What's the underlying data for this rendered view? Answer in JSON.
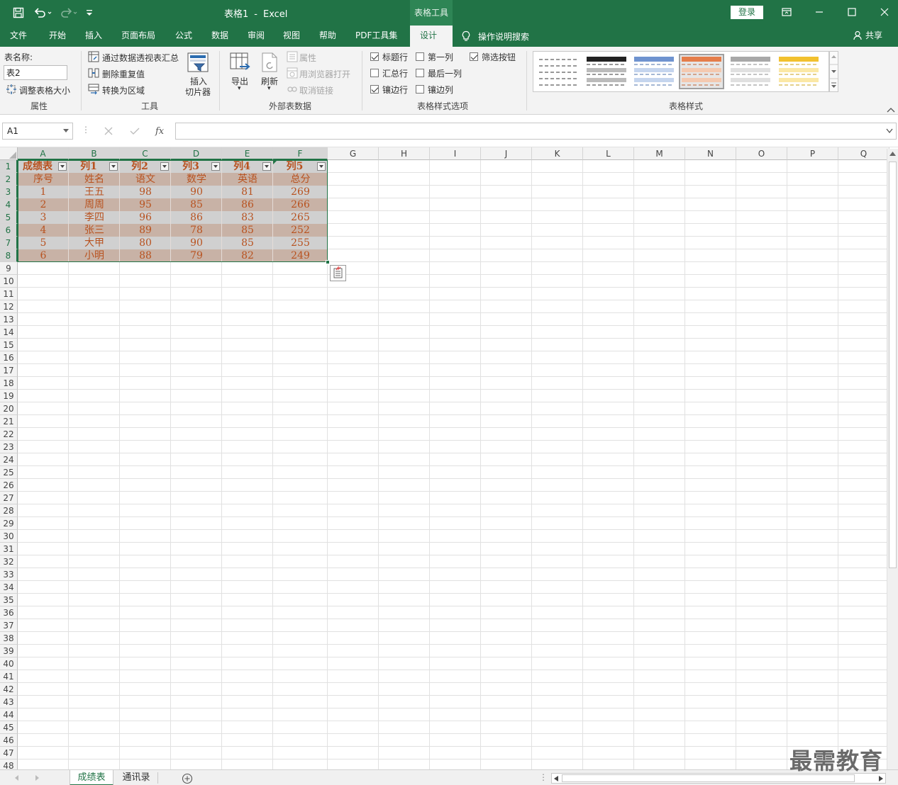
{
  "window": {
    "doc_title": "表格1",
    "separator": "-",
    "app_name": "Excel",
    "context_group": "表格工具",
    "login_label": "登录",
    "brand_color": "#217346"
  },
  "tabs": {
    "file": "文件",
    "home": "开始",
    "insert": "插入",
    "layout": "页面布局",
    "formulas": "公式",
    "data": "数据",
    "review": "审阅",
    "view": "视图",
    "help": "帮助",
    "pdf": "PDF工具集",
    "design": "设计",
    "tell_me": "操作说明搜索",
    "share": "共享"
  },
  "ribbon": {
    "properties": {
      "name_label": "表名称:",
      "name_value": "表2",
      "resize": "调整表格大小",
      "group": "属性"
    },
    "tools": {
      "pivot": "通过数据透视表汇总",
      "dedupe": "删除重复值",
      "to_range": "转换为区域",
      "slicer_line1": "插入",
      "slicer_line2": "切片器",
      "group": "工具"
    },
    "external": {
      "export": "导出",
      "refresh": "刷新",
      "properties": "属性",
      "browser": "用浏览器打开",
      "unlink": "取消链接",
      "group": "外部表数据"
    },
    "style_options": {
      "header_row": {
        "label": "标题行",
        "checked": true
      },
      "total_row": {
        "label": "汇总行",
        "checked": false
      },
      "banded_rows": {
        "label": "镶边行",
        "checked": true
      },
      "first_col": {
        "label": "第一列",
        "checked": false
      },
      "last_col": {
        "label": "最后一列",
        "checked": false
      },
      "banded_cols": {
        "label": "镶边列",
        "checked": false
      },
      "filter_btn": {
        "label": "筛选按钮",
        "checked": true
      },
      "group": "表格样式选项"
    },
    "table_styles": {
      "group": "表格样式"
    }
  },
  "formula_bar": {
    "name_box": "A1",
    "fx": "fx",
    "formula": ""
  },
  "sheet": {
    "columns": [
      "A",
      "B",
      "C",
      "D",
      "E",
      "F",
      "G",
      "H",
      "I",
      "J",
      "K",
      "L",
      "M",
      "N",
      "O",
      "P",
      "Q"
    ],
    "selected_columns": [
      "A",
      "B",
      "C",
      "D",
      "E",
      "F"
    ],
    "row_count": 48,
    "table_header": [
      "成绩表",
      "列1",
      "列2",
      "列3",
      "列4",
      "列5"
    ],
    "table_rows": [
      [
        "序号",
        "姓名",
        "语文",
        "数学",
        "英语",
        "总分"
      ],
      [
        "1",
        "王五",
        "98",
        "90",
        "81",
        "269"
      ],
      [
        "2",
        "周周",
        "95",
        "85",
        "86",
        "266"
      ],
      [
        "3",
        "李四",
        "96",
        "86",
        "83",
        "265"
      ],
      [
        "4",
        "张三",
        "89",
        "78",
        "85",
        "252"
      ],
      [
        "5",
        "大甲",
        "80",
        "90",
        "85",
        "255"
      ],
      [
        "6",
        "小明",
        "88",
        "79",
        "82",
        "249"
      ]
    ],
    "colors": {
      "band_dark": "#c8b2a6",
      "band_light": "#d0d0d0",
      "text": "#b8521f",
      "border": "#217346"
    }
  },
  "sheet_tabs": [
    "成绩表",
    "通讯录"
  ],
  "active_sheet": "成绩表",
  "watermark": "最需教育"
}
